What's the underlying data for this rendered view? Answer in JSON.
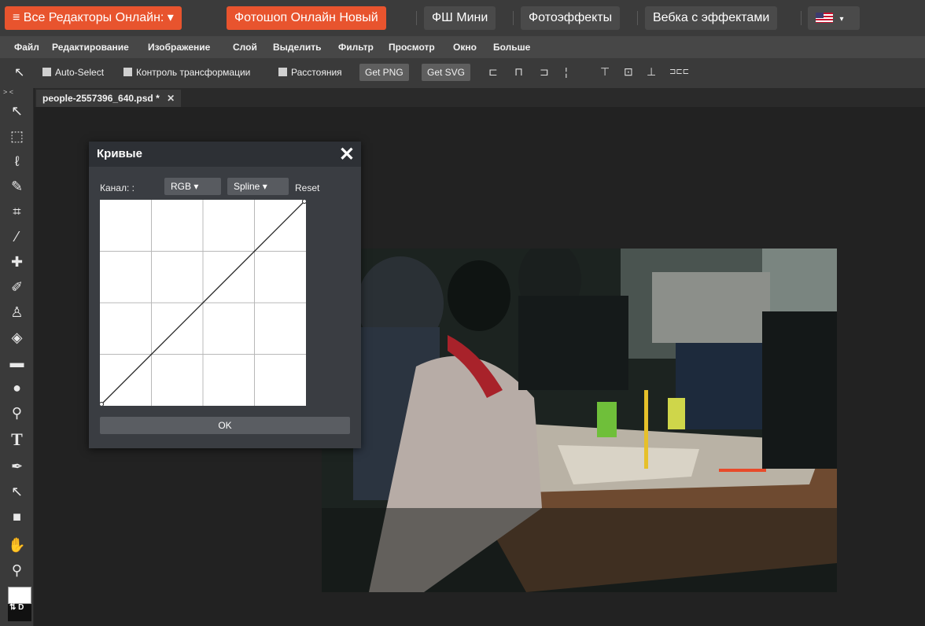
{
  "topnav": {
    "editors_menu": "≡ Все Редакторы Онлайн: ▾",
    "photoshop_new": "Фотошоп Онлайн Новый",
    "fs_mini": "ФШ Мини",
    "photo_effects": "Фотоэффекты",
    "webcam_effects": "Вебка с эффектами",
    "lang_caret": "▾"
  },
  "menu": {
    "items": [
      "Файл",
      "Редактирование",
      "Изображение",
      "Слой",
      "Выделить",
      "Фильтр",
      "Просмотр",
      "Окно",
      "Больше"
    ]
  },
  "options": {
    "auto_select": "Auto-Select",
    "transform_controls": "Контроль трансформации",
    "distances": "Расстояния",
    "get_png": "Get PNG",
    "get_svg": "Get SVG"
  },
  "toolbar": {
    "collapse": "> <",
    "swap_default": "⇅ D"
  },
  "document": {
    "tab_name": "people-2557396_640.psd *",
    "close": "✕"
  },
  "dialog": {
    "title": "Кривые",
    "close": "✕",
    "channel_label": "Канал: :",
    "channel_value": "RGB ▾",
    "mode_value": "Spline ▾",
    "reset": "Reset",
    "ok": "OK"
  },
  "colors": {
    "accent": "#e8542e",
    "panel": "#3a3a3a",
    "background": "#222222"
  }
}
